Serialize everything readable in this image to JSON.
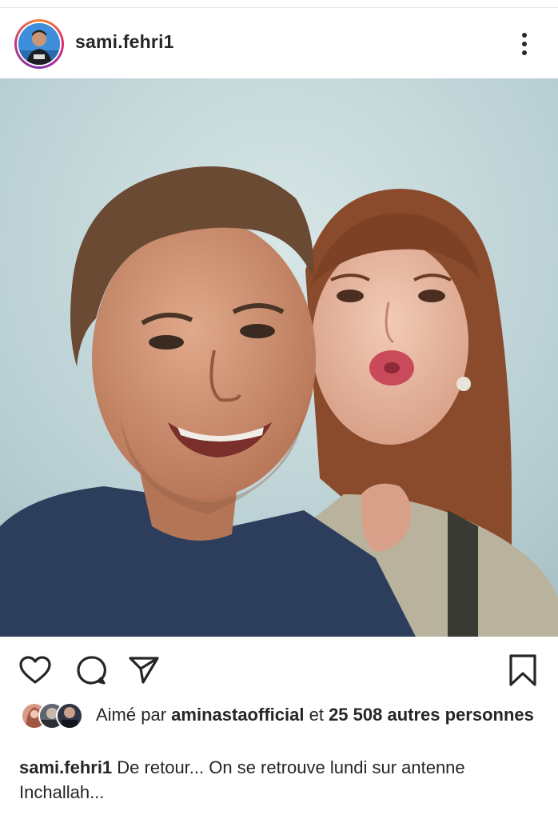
{
  "post": {
    "username": "sami.fehri1",
    "avatar_icon": "profile-avatar",
    "more_icon": "more-vertical-icon"
  },
  "actions": {
    "like_icon": "heart-icon",
    "comment_icon": "comment-icon",
    "share_icon": "send-icon",
    "save_icon": "bookmark-icon"
  },
  "likes": {
    "prefix": "Aimé par",
    "liker": "aminastaofficial",
    "connector": "et",
    "others": "25 508 autres personnes"
  },
  "caption": {
    "username": "sami.fehri1",
    "text": "De retour... On se retrouve lundi sur antenne Inchallah..."
  },
  "colors": {
    "text": "#262626",
    "avatar_ring_start": "#f58529",
    "avatar_ring_end": "#dd2a7b",
    "background": "#ffffff"
  }
}
